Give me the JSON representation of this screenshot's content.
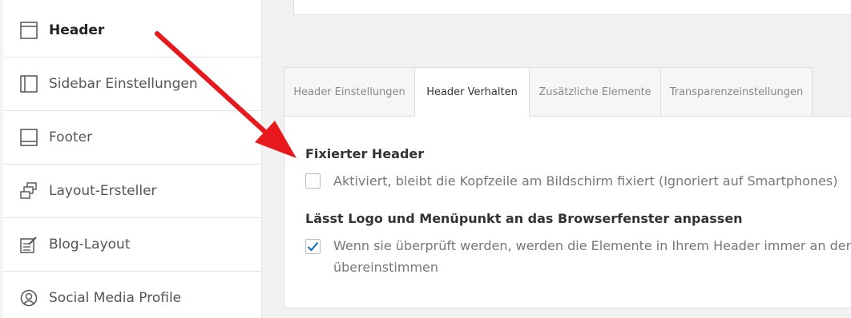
{
  "sidebar": {
    "items": [
      {
        "label": "Header",
        "icon": "header-icon",
        "active": true
      },
      {
        "label": "Sidebar Einstellungen",
        "icon": "sidebar-icon",
        "active": false
      },
      {
        "label": "Footer",
        "icon": "footer-icon",
        "active": false
      },
      {
        "label": "Layout-Ersteller",
        "icon": "layout-builder-icon",
        "active": false
      },
      {
        "label": "Blog-Layout",
        "icon": "blog-layout-icon",
        "active": false
      },
      {
        "label": "Social Media Profile",
        "icon": "social-profile-icon",
        "active": false
      }
    ]
  },
  "tabs": [
    {
      "label": "Header Einstellungen",
      "active": false
    },
    {
      "label": "Header Verhalten",
      "active": true
    },
    {
      "label": "Zusätzliche Elemente",
      "active": false
    },
    {
      "label": "Transparenzeinstellungen",
      "active": false
    }
  ],
  "options": [
    {
      "title": "Fixierter Header",
      "checked": false,
      "description": "Aktiviert, bleibt die Kopfzeile am Bildschirm fixiert (Ignoriert auf Smartphones)"
    },
    {
      "title": "Lässt Logo und Menüpunkt an das Browserfenster anpassen",
      "checked": true,
      "description_line1": "Wenn sie überprüft werden, werden die Elemente in Ihrem Header immer an der Bro",
      "description_line2": "übereinstimmen"
    }
  ],
  "colors": {
    "annotation_arrow": "#e8191c",
    "checkbox_check": "#1e73be"
  }
}
